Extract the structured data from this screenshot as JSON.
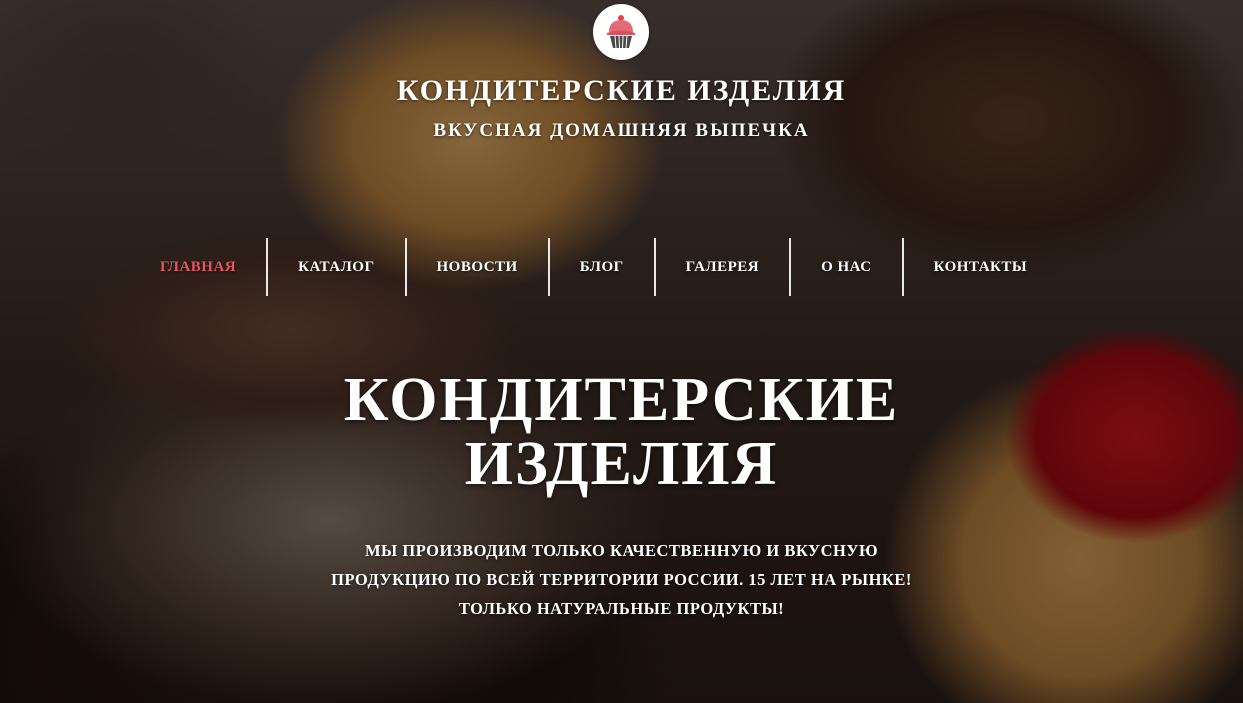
{
  "header": {
    "logo_icon": "cupcake-icon",
    "title": "КОНДИТЕРСКИЕ ИЗДЕЛИЯ",
    "subtitle": "ВКУСНАЯ ДОМАШНЯЯ ВЫПЕЧКА"
  },
  "nav": {
    "items": [
      {
        "label": "ГЛАВНАЯ",
        "active": true
      },
      {
        "label": "КАТАЛОГ",
        "active": false
      },
      {
        "label": "НОВОСТИ",
        "active": false
      },
      {
        "label": "БЛОГ",
        "active": false
      },
      {
        "label": "ГАЛЕРЕЯ",
        "active": false
      },
      {
        "label": "О НАС",
        "active": false
      },
      {
        "label": "КОНТАКТЫ",
        "active": false
      }
    ],
    "active_color": "#e65566"
  },
  "hero": {
    "title_line1": "КОНДИТЕРСКИЕ",
    "title_line2": "ИЗДЕЛИЯ",
    "text_line1": "МЫ ПРОИЗВОДИМ ТОЛЬКО КАЧЕСТВЕННУЮ И ВКУСНУЮ",
    "text_line2": "ПРОДУКЦИЮ ПО ВСЕЙ ТЕРРИТОРИИ РОССИИ. 15 ЛЕТ НА РЫНКЕ!",
    "text_line3": "ТОЛЬКО НАТУРАЛЬНЫЕ ПРОДУКТЫ!"
  }
}
